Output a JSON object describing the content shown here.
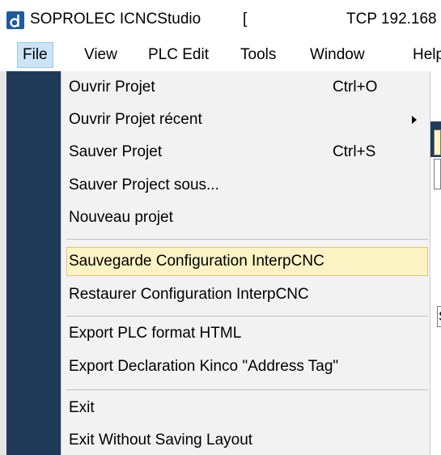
{
  "window": {
    "title": "SOPROLEC ICNCStudio",
    "title_bracket": "[",
    "connection": "TCP 192.168"
  },
  "menubar": {
    "items": [
      {
        "label": "File"
      },
      {
        "label": "View"
      },
      {
        "label": "PLC Edit"
      },
      {
        "label": "Tools"
      },
      {
        "label": "Window"
      },
      {
        "label": "Help"
      }
    ]
  },
  "file_menu": {
    "open_project": "Ouvrir Projet",
    "open_project_shortcut": "Ctrl+O",
    "open_recent": "Ouvrir Projet récent",
    "save_project": "Sauver Projet",
    "save_project_shortcut": "Ctrl+S",
    "save_project_as": "Sauver Project sous...",
    "new_project": "Nouveau projet",
    "backup_config": "Sauvegarde Configuration InterpCNC",
    "restore_config": "Restaurer Configuration InterpCNC",
    "export_html": "Export PLC format HTML",
    "export_kinco": "Export Declaration Kinco \"Address Tag\"",
    "exit": "Exit",
    "exit_without_saving": "Exit Without Saving Layout"
  },
  "background": {
    "tooltip_fragment": "S"
  },
  "colors": {
    "menu_background": "#f2f2f2",
    "highlight_fill": "#fcf3c4",
    "highlight_border": "#e3c66f",
    "active_menu_fill": "#cce4f7",
    "app_dark": "#1f3a59",
    "app_icon": "#1e5b9e"
  },
  "icons": {
    "app": "app-logo-icon",
    "submenu": "chevron-right-icon"
  }
}
